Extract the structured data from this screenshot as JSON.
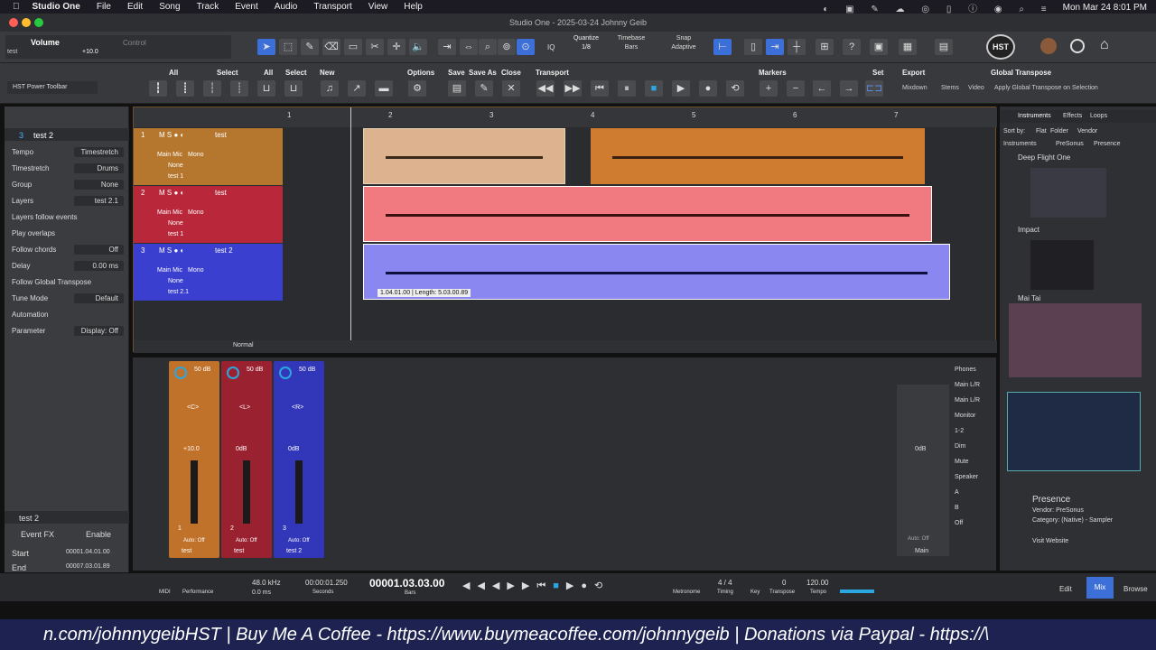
{
  "menubar": {
    "app": "Studio One",
    "items": [
      "File",
      "Edit",
      "Song",
      "Track",
      "Event",
      "Audio",
      "Transport",
      "View",
      "Help"
    ],
    "clock": "Mon Mar 24  8:01 PM"
  },
  "titlebar": {
    "title": "Studio One - 2025-03-24 Johnny Geib"
  },
  "toolbar1": {
    "channel_label": "Volume",
    "channel_sub": "test",
    "volume_value": "+10.0",
    "control_label": "Control",
    "quantize_label": "Quantize",
    "quantize_value": "1/8",
    "timebase_label": "Timebase",
    "timebase_value": "Bars",
    "snap_label": "Snap",
    "snap_value": "Adaptive",
    "logo": "HST"
  },
  "toolbar2": {
    "preset_name": "HST Power Toolbar",
    "groups": {
      "all1": "All",
      "select1": "Select",
      "all2": "All",
      "select2": "Select",
      "new": "New",
      "options": "Options",
      "save": "Save",
      "saveas": "Save As",
      "close": "Close",
      "transport": "Transport",
      "markers": "Markers",
      "set": "Set",
      "export": "Export",
      "global_transpose": "Global Transpose"
    },
    "export_items": {
      "mixdown": "Mixdown",
      "stems": "Stems",
      "video": "Video",
      "apply_transpose": "Apply Global Transpose on Selection"
    }
  },
  "inspector": {
    "track_number": "3",
    "track_name": "test 2",
    "rows": [
      {
        "k": "Tempo",
        "v": "Timestretch"
      },
      {
        "k": "Timestretch",
        "v": "Drums"
      },
      {
        "k": "Group",
        "v": "None"
      },
      {
        "k": "Layers",
        "v": "test 2.1"
      },
      {
        "k": "Layers follow events",
        "v": ""
      },
      {
        "k": "Play overlaps",
        "v": ""
      },
      {
        "k": "Follow chords",
        "v": "Off"
      },
      {
        "k": "Delay",
        "v": "0.00 ms"
      },
      {
        "k": "Follow Global Transpose",
        "v": ""
      },
      {
        "k": "Tune Mode",
        "v": "Default"
      },
      {
        "k": "Automation",
        "v": ""
      },
      {
        "k": "Parameter",
        "v": "Display: Off"
      }
    ],
    "event": {
      "name": "test 2",
      "fx_label": "Event FX",
      "enable_label": "Enable",
      "start_label": "Start",
      "start_value": "00001.04.01.00",
      "end_label": "End",
      "end_value": "00007.03.01.89"
    }
  },
  "arrange": {
    "ruler": [
      "1",
      "2",
      "3",
      "4",
      "5",
      "6",
      "7"
    ],
    "tracks": [
      {
        "num": "1",
        "name": "test",
        "input": "Main Mic",
        "mono": "Mono",
        "none": "None",
        "layer": "test 1",
        "color": "#b5772e"
      },
      {
        "num": "2",
        "name": "test",
        "input": "Main Mic",
        "mono": "Mono",
        "none": "None",
        "layer": "test 1",
        "color": "#b8283a"
      },
      {
        "num": "3",
        "name": "test 2",
        "input": "Main Mic",
        "mono": "Mono",
        "none": "None",
        "layer": "test 2.1",
        "color": "#3a3fd0"
      }
    ],
    "tooltip": "1.04.01.00 | Length: 5.03.00.89",
    "bottom_mode": "Normal"
  },
  "mixer": {
    "strips": [
      {
        "gain": "50 dB",
        "pan": "<C>",
        "volume": "+10.0",
        "num": "1",
        "name": "test",
        "auto": "Auto: Off",
        "color": "#c0712a"
      },
      {
        "gain": "50 dB",
        "pan": "<L>",
        "volume": "0dB",
        "num": "2",
        "name": "test",
        "auto": "Auto: Off",
        "color": "#9a2230"
      },
      {
        "gain": "50 dB",
        "pan": "<R>",
        "volume": "0dB",
        "num": "3",
        "name": "test 2",
        "auto": "Auto: Off",
        "color": "#3236b8"
      }
    ],
    "main": {
      "volume": "0dB",
      "auto": "Auto: Off",
      "name": "Main"
    },
    "outputs": [
      "Phones",
      "Main L/R",
      "Main L/R",
      "Monitor",
      "1-2",
      "Dim",
      "Mute",
      "Speaker",
      "A",
      "B",
      "Off"
    ]
  },
  "browser": {
    "tabs": [
      "Instruments",
      "Effects",
      "Loops"
    ],
    "sort_by": "Sort by:",
    "sort_options": [
      "Flat",
      "Folder",
      "Vendor"
    ],
    "path": [
      "Instruments",
      "PreSonus",
      "Presence"
    ],
    "items": [
      "Deep Flight One",
      "Impact",
      "Mai Tai"
    ],
    "info_title": "Presence",
    "info_vendor": "Vendor:   PreSonus",
    "info_category": "Category:  (Native) - Sampler",
    "visit": "Visit Website"
  },
  "transport": {
    "midi": "MIDI",
    "performance": "Performance",
    "sample_rate": "48.0 kHz",
    "latency": "0.0 ms",
    "seconds": "00:00:01.250",
    "seconds_label": "Seconds",
    "bars": "00001.03.03.00",
    "bars_label": "Bars",
    "metronome": "Metronome",
    "timing": "Timing",
    "signature": "4 / 4",
    "key": "Key",
    "transpose_value": "0",
    "transpose": "Transpose",
    "tempo_value": "120.00",
    "tempo": "Tempo",
    "edit": "Edit",
    "mix": "Mix",
    "browse": "Browse"
  },
  "footer": {
    "text": "n.com/johnnygeibHST | Buy Me A Coffee - https://www.buymeacoffee.com/johnnygeib | Donations via Paypal - https://\\"
  }
}
